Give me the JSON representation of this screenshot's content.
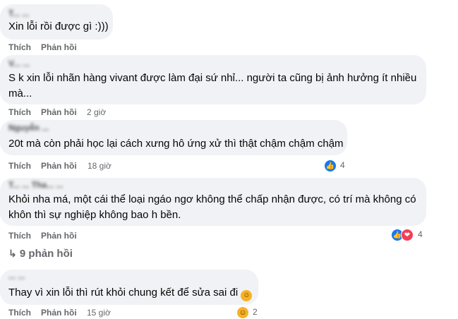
{
  "comments": [
    {
      "author": "T... ...",
      "text": "Xin lỗi rồi được gì :)))",
      "actions": {
        "like": "Thích",
        "reply": "Phản hồi"
      }
    },
    {
      "author": "V... ...",
      "text": "S k xin lỗi nhãn hàng vivant được làm đại sứ nhỉ... người ta cũng bị ảnh hưởng ít nhiều mà...",
      "actions": {
        "like": "Thích",
        "reply": "Phản hồi",
        "time": "2 giờ"
      }
    },
    {
      "author": "Nguyễn ...",
      "text": "20t mà còn phải học lại cách xưng hô ứng xử thì thật chậm chậm chậm",
      "actions": {
        "like": "Thích",
        "reply": "Phản hồi",
        "time": "18 giờ"
      },
      "reactions": {
        "icons": [
          "like-icon"
        ],
        "count": "4"
      }
    },
    {
      "author": "T... ... Tha... ...",
      "text": "Khỏi nha má, một cái thể loại ngáo ngơ không thể chấp nhận được, có trí mà không có khôn thì sự nghiệp không bao h bền.",
      "actions": {
        "like": "Thích",
        "reply": "Phản hồi"
      },
      "reactions": {
        "icons": [
          "like-icon",
          "love-icon"
        ],
        "count": "4"
      }
    },
    {
      "author": "... ...",
      "text": "Thay vì xin lỗi thì rút khỏi chung kết để sửa sai đi",
      "actions": {
        "like": "Thích",
        "reply": "Phản hồi",
        "time": "15 giờ"
      },
      "reactions": {
        "icons": [
          "haha-icon"
        ],
        "count": "2"
      }
    }
  ],
  "replies_link": "9 phản hồi",
  "colors": {
    "bubble": "#f0f2f5",
    "meta": "#65676b",
    "like": "#1877f2",
    "love": "#f33e58",
    "haha": "#f7b125"
  }
}
